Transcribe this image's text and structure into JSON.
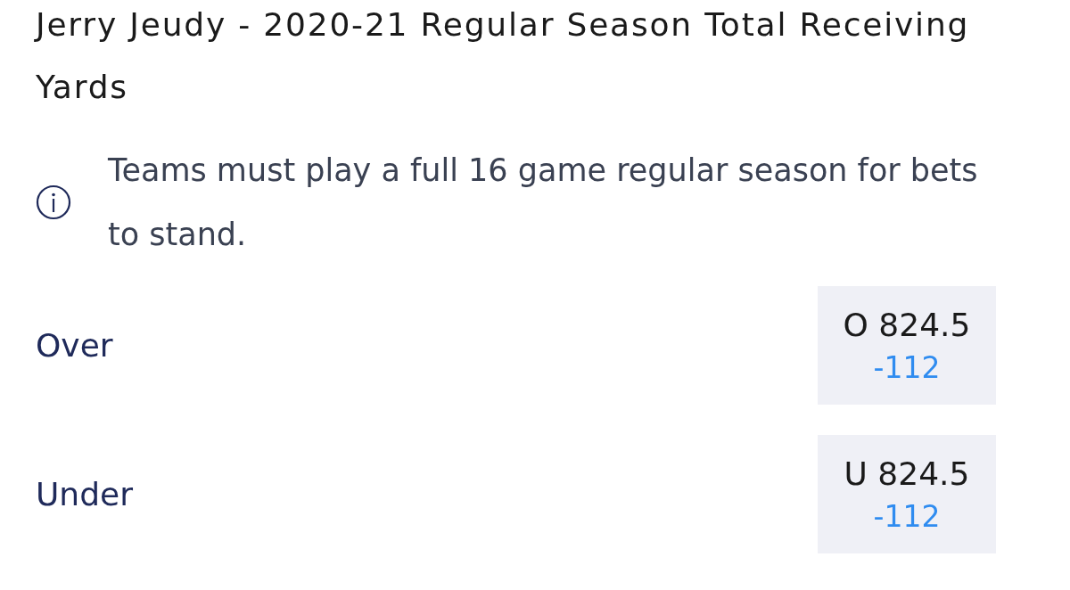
{
  "title": "Jerry Jeudy - 2020-21 Regular Season Total Receiving Yards",
  "notice": "Teams must play a full 16 game regular season for bets to stand.",
  "outcomes": [
    {
      "label": "Over",
      "line": "O 824.5",
      "odds": "-112"
    },
    {
      "label": "Under",
      "line": "U 824.5",
      "odds": "-112"
    }
  ]
}
